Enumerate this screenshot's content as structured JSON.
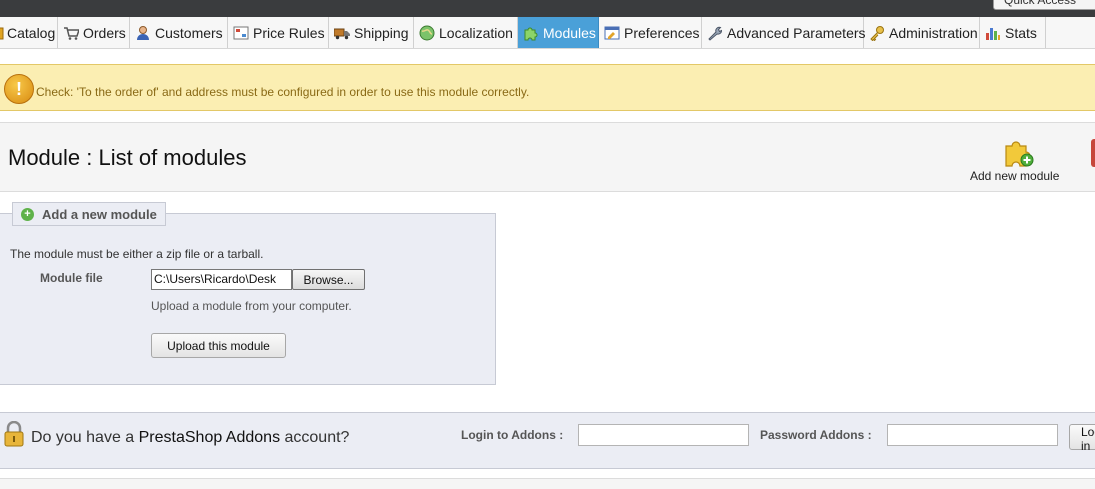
{
  "header": {
    "quick_access": "Quick Access"
  },
  "tabs": [
    {
      "label": "Catalog",
      "icon": "catalog-icon"
    },
    {
      "label": "Orders",
      "icon": "cart-icon"
    },
    {
      "label": "Customers",
      "icon": "customer-icon"
    },
    {
      "label": "Price Rules",
      "icon": "price-rules-icon"
    },
    {
      "label": "Shipping",
      "icon": "truck-icon"
    },
    {
      "label": "Localization",
      "icon": "globe-icon"
    },
    {
      "label": "Modules",
      "icon": "puzzle-icon",
      "active": true
    },
    {
      "label": "Preferences",
      "icon": "preferences-icon"
    },
    {
      "label": "Advanced Parameters",
      "icon": "wrench-icon"
    },
    {
      "label": "Administration",
      "icon": "key-icon"
    },
    {
      "label": "Stats",
      "icon": "bar-chart-icon"
    }
  ],
  "warning": {
    "icon": "warning-icon",
    "text": "Check: 'To the order of' and address must be configured in order to use this module correctly."
  },
  "page": {
    "title": "Module : List of modules",
    "add_module_label": "Add new module"
  },
  "upload_form": {
    "legend": "Add a new module",
    "hint": "The module must be either a zip file or a tarball.",
    "file_label": "Module file",
    "file_value": "C:\\Users\\Ricardo\\Desk",
    "browse_label": "Browse...",
    "upload_hint": "Upload a module from your computer.",
    "upload_button": "Upload this module"
  },
  "addons": {
    "question_prefix": "Do you have a ",
    "brand": "PrestaShop Addons",
    "question_suffix": " account?",
    "login_label": "Login to Addons :",
    "password_label": "Password Addons :",
    "login_button": "Log in"
  },
  "colors": {
    "active_tab": "#4aa0d8",
    "warning_bg": "#fbeeb2",
    "warning_text": "#8a6a16",
    "form_bg": "#ebedf4"
  }
}
